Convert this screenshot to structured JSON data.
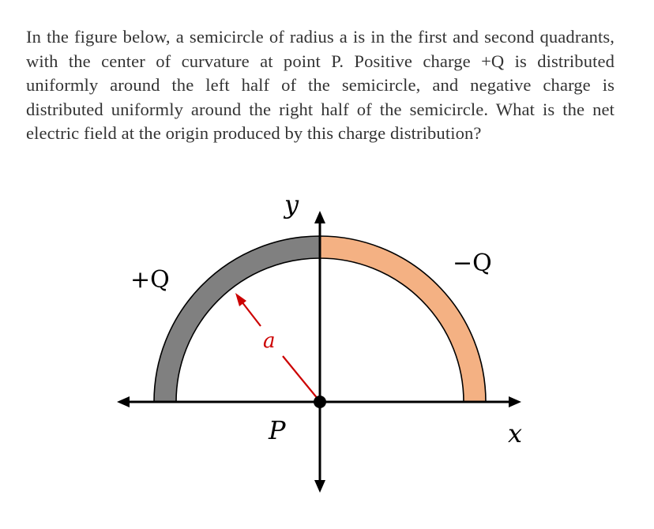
{
  "question": {
    "text": "In the figure below, a semicircle of radius a is in the first and second quadrants, with the center of curvature at point P. Positive charge +Q is distributed uniformly around the left half of the semicircle, and negative charge is distributed uniformly around the right half of the semicircle. What is the net electric field at the origin produced by this charge distribution?"
  },
  "figure": {
    "labels": {
      "y_axis": "y",
      "x_axis": "x",
      "positive_charge": "+Q",
      "negative_charge": "−Q",
      "radius": "a",
      "center": "P"
    },
    "colors": {
      "positive_arc": "#808080",
      "negative_arc": "#F4B183",
      "radius_arrow": "#CC0000",
      "axes": "#000000"
    }
  }
}
